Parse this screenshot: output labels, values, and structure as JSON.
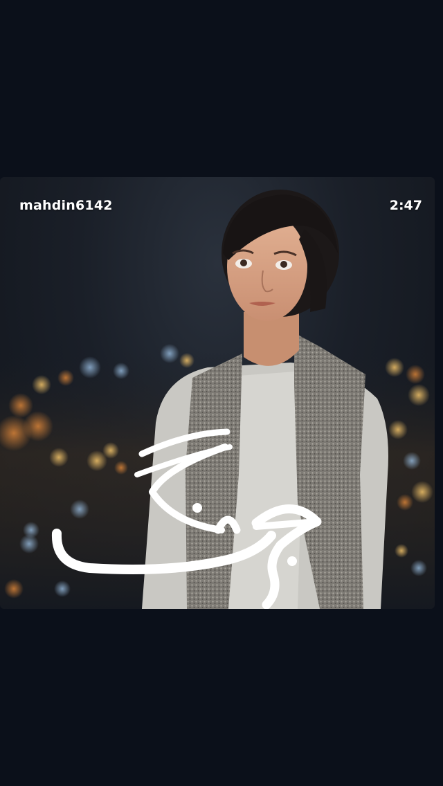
{
  "video": {
    "username": "mahdin6142",
    "duration": "2:47",
    "overlay_text": "جنگ"
  },
  "colors": {
    "background": "#0b101a",
    "overlay_text": "#ffffff"
  }
}
